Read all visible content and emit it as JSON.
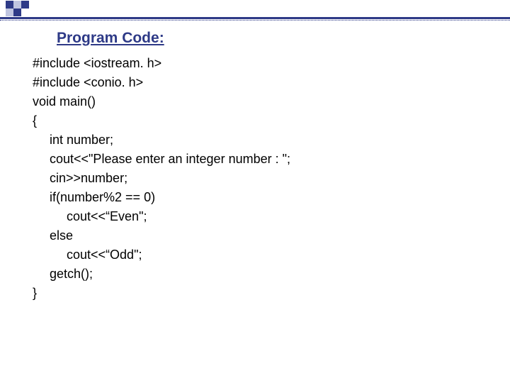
{
  "heading": "Program Code:",
  "code": {
    "lines": [
      {
        "text": "#include <iostream. h>",
        "indent": 0
      },
      {
        "text": "#include <conio. h>",
        "indent": 0
      },
      {
        "text": "void main()",
        "indent": 0
      },
      {
        "text": "{",
        "indent": 0
      },
      {
        "text": "int number;",
        "indent": 1
      },
      {
        "text": "cout<<\"Please enter an integer number : \";",
        "indent": 1
      },
      {
        "text": "cin>>number;",
        "indent": 1
      },
      {
        "text": "if(number%2 == 0)",
        "indent": 1
      },
      {
        "text": "cout<<“Even\";",
        "indent": 2
      },
      {
        "text": "else",
        "indent": 1
      },
      {
        "text": "cout<<“Odd\";",
        "indent": 2
      },
      {
        "text": "getch();",
        "indent": 1
      },
      {
        "text": "}",
        "indent": 0
      }
    ]
  }
}
